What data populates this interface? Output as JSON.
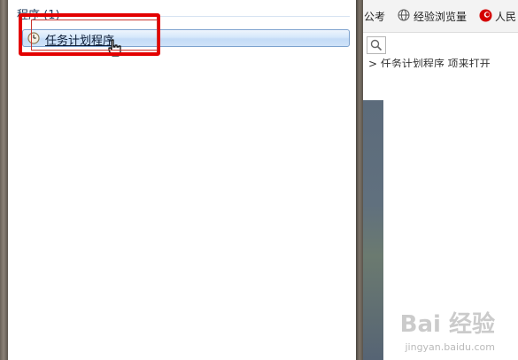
{
  "start_menu": {
    "section_title": "程序 (1)",
    "results": [
      {
        "label": "任务计划程序",
        "icon": "clock-icon"
      }
    ]
  },
  "browser": {
    "favorites": [
      {
        "label": "公考"
      },
      {
        "label": "经验浏览量",
        "icon": "globe-icon"
      },
      {
        "label": "人民",
        "icon": "people-icon"
      }
    ],
    "breadcrumb": "> 任务计划程序 项来打开"
  },
  "watermark": {
    "logo_text": "Bai 经验",
    "url": "jingyan.baidu.com"
  },
  "colors": {
    "highlight": "#e30000",
    "selection": "#cfe2f8"
  }
}
